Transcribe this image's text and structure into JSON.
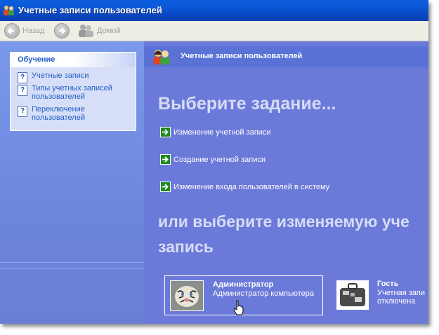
{
  "window": {
    "title": "Учетные записи пользователей"
  },
  "toolbar": {
    "back_label": "Назад",
    "home_label": "Домой"
  },
  "sidebar": {
    "panel_title": "Обучение",
    "items": [
      {
        "label": "Учетные записи",
        "icon": "help-icon"
      },
      {
        "label": "Типы учетных записей пользователей",
        "icon": "help-icon"
      },
      {
        "label": "Переключение пользователей",
        "icon": "help-icon"
      }
    ]
  },
  "main": {
    "header_title": "Учетные записи пользователей",
    "pick_task_heading": "Выберите задание...",
    "tasks": [
      {
        "label": "Изменение учетной записи",
        "icon": "green-arrow-icon"
      },
      {
        "label": "Создание учетной записи",
        "icon": "green-arrow-icon"
      },
      {
        "label": "Изменение входа пользователей в систему",
        "icon": "green-arrow-icon"
      }
    ],
    "pick_account_heading_line1": "или выберите изменяемую уче",
    "pick_account_heading_line2": "запись",
    "accounts": [
      {
        "name": "Администратор",
        "desc1": "Администратор компьютера",
        "desc2": ""
      },
      {
        "name": "Гость",
        "desc1": "Учетная запи",
        "desc2": "отключена"
      }
    ]
  },
  "colors": {
    "titlebar": "#0a5ede",
    "main_bg": "#6b7ad9",
    "link": "#215dc6",
    "task_arrow": "#1f8a1f"
  }
}
